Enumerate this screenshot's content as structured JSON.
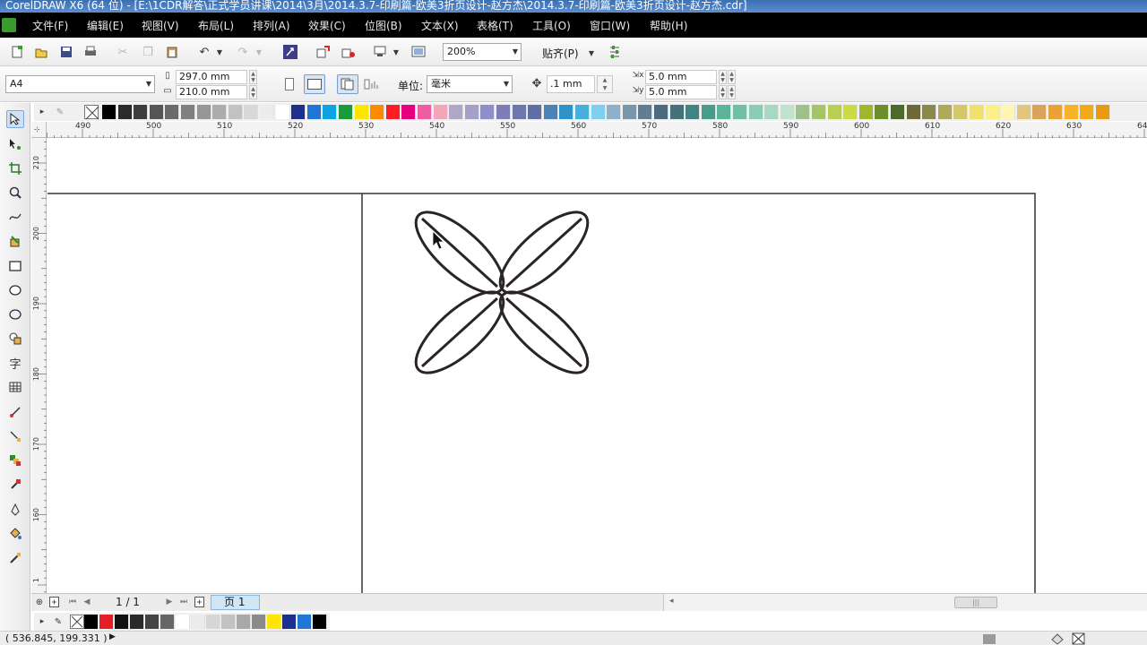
{
  "window": {
    "title": "CorelDRAW X6 (64 位) - [E:\\1CDR解答\\正式学员讲课\\2014\\3月\\2014.3.7-印刷篇-欧美3折页设计-赵方杰\\2014.3.7-印刷篇-欧美3折页设计-赵方杰.cdr]"
  },
  "menu": [
    "文件(F)",
    "编辑(E)",
    "视图(V)",
    "布局(L)",
    "排列(A)",
    "效果(C)",
    "位图(B)",
    "文本(X)",
    "表格(T)",
    "工具(O)",
    "窗口(W)",
    "帮助(H)"
  ],
  "standard_toolbar": {
    "zoom": "200%",
    "snap_label": "贴齐(P)"
  },
  "property_bar": {
    "paper_size": "A4",
    "width": "297.0 mm",
    "height": "210.0 mm",
    "units_label": "单位:",
    "units_value": "毫米",
    "nudge": ".1 mm",
    "dup_x": "5.0 mm",
    "dup_y": "5.0 mm"
  },
  "palette_colors": [
    "#000000",
    "#2b2b2b",
    "#3d3d3d",
    "#555555",
    "#6a6a6a",
    "#808080",
    "#969696",
    "#acacac",
    "#c2c2c2",
    "#d8d8d8",
    "#ececec",
    "#ffffff",
    "#1d2f8f",
    "#1f76d6",
    "#0ca3e3",
    "#1a9a3b",
    "#ffe600",
    "#ff8a00",
    "#ff1d25",
    "#e6007e",
    "#f05ca0",
    "#f3a6b8",
    "#b0a7c7",
    "#a4a0c8",
    "#8e8fca",
    "#7f7cb6",
    "#6d78ad",
    "#5d6fa4",
    "#4d82b8",
    "#2f93c8",
    "#45b0e0",
    "#7fcfee",
    "#8fb0c8",
    "#7897ad",
    "#5f7d93",
    "#4e6a7e",
    "#44717a",
    "#3f8480",
    "#4a9c8a",
    "#5db39a",
    "#6fc0a6",
    "#8acdb4",
    "#a6d8c3",
    "#bfe3ce",
    "#9fc08c",
    "#a3c46a",
    "#b8cf55",
    "#cddb42",
    "#9fb62f",
    "#6e8c2b",
    "#4c6a2a",
    "#6c6a3a",
    "#8c874a",
    "#b0a85a",
    "#d4c86a",
    "#efe06f",
    "#fbf08a",
    "#fff6b0",
    "#e2c680",
    "#d9a45a",
    "#eaa13a",
    "#f7b228",
    "#f2a91e",
    "#e99a12"
  ],
  "bottom_palette": [
    "#000000",
    "#e31e24",
    "#111111",
    "#2a2a2a",
    "#444444",
    "#666666",
    "#ffffff",
    "#ebebeb",
    "#d6d6d6",
    "#c2c2c2",
    "#a8a8a8",
    "#8a8a8a",
    "#ffe600",
    "#1d2f8f",
    "#1f76d6",
    "#000000"
  ],
  "ruler": {
    "h_labels": [
      "490",
      "500",
      "510",
      "520",
      "530",
      "540",
      "550",
      "560",
      "570",
      "580",
      "590",
      "600",
      "610",
      "620",
      "630",
      "64"
    ],
    "v_labels": [
      "210",
      "200",
      "190",
      "180",
      "170",
      "160",
      "1"
    ]
  },
  "page_nav": {
    "page_count": "1 / 1",
    "page_tab": "页 1"
  },
  "status": {
    "coords": "( 536.845, 199.331 )"
  }
}
